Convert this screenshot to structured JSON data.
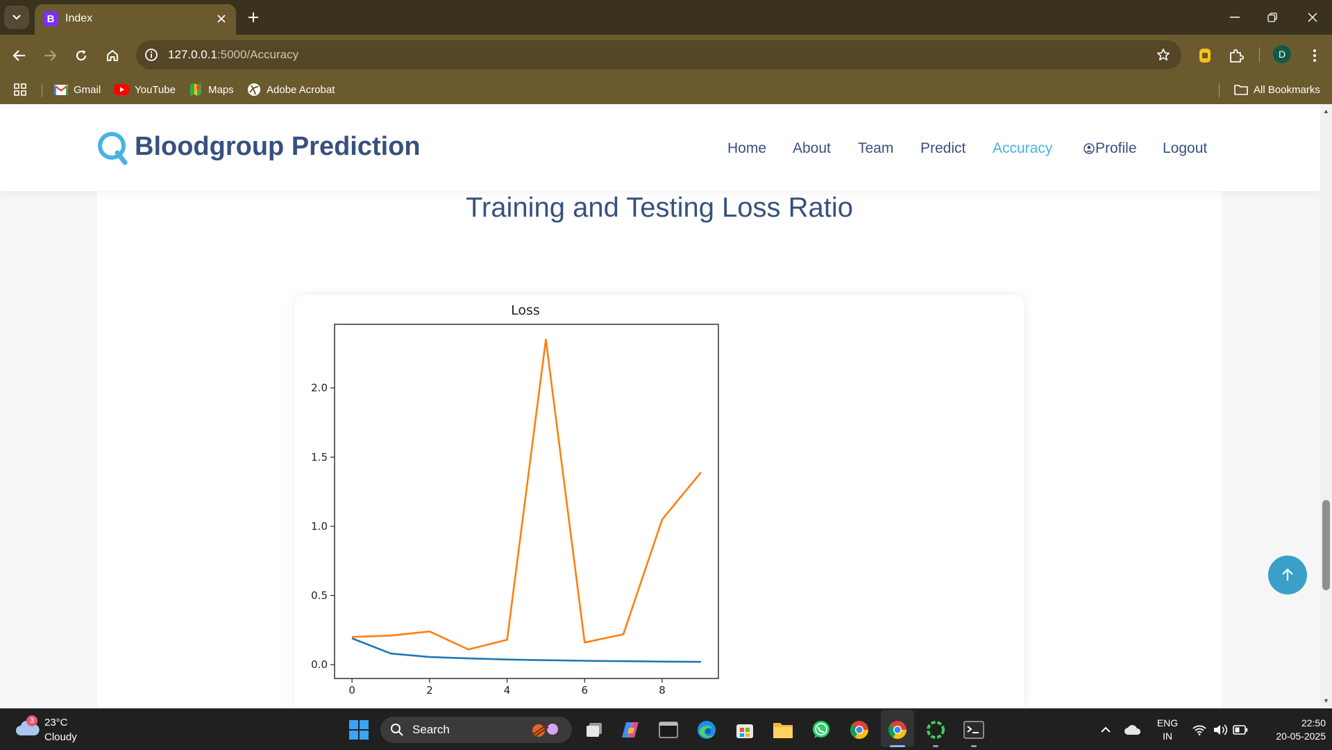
{
  "browser": {
    "tab_title": "Index",
    "tab_favicon_letter": "B",
    "url_host": "127.0.0.1",
    "url_rest": ":5000/Accuracy",
    "profile_initial": "D",
    "bookmarks": [
      {
        "label": "Gmail",
        "icon": "gmail-icon"
      },
      {
        "label": "YouTube",
        "icon": "youtube-icon"
      },
      {
        "label": "Maps",
        "icon": "maps-icon"
      },
      {
        "label": "Adobe Acrobat",
        "icon": "acrobat-icon"
      }
    ],
    "all_bookmarks_label": "All Bookmarks"
  },
  "site": {
    "brand": "Bloodgroup Prediction",
    "accent_color": "#47b2e4",
    "nav": [
      {
        "label": "Home",
        "active": false
      },
      {
        "label": "About",
        "active": false
      },
      {
        "label": "Team",
        "active": false
      },
      {
        "label": "Predict",
        "active": false
      },
      {
        "label": "Accuracy",
        "active": true
      },
      {
        "label": "Profile",
        "active": false
      },
      {
        "label": "Logout",
        "active": false
      }
    ],
    "section_title": "Training and Testing Loss Ratio"
  },
  "chart_data": {
    "type": "line",
    "title": "Loss",
    "xlabel": "",
    "ylabel": "",
    "x": [
      0,
      1,
      2,
      3,
      4,
      5,
      6,
      7,
      8,
      9
    ],
    "xticks": [
      0,
      2,
      4,
      6,
      8
    ],
    "yticks": [
      "0.0",
      "0.5",
      "1.0",
      "1.5",
      "2.0"
    ],
    "xlim": [
      -0.45,
      9.45
    ],
    "ylim": [
      -0.1,
      2.46
    ],
    "grid": false,
    "series": [
      {
        "color": "#1f77b4",
        "values": [
          0.19,
          0.08,
          0.055,
          0.045,
          0.037,
          0.032,
          0.028,
          0.025,
          0.022,
          0.02
        ]
      },
      {
        "color": "#ff7f0e",
        "values": [
          0.2,
          0.21,
          0.24,
          0.11,
          0.18,
          2.35,
          0.16,
          0.22,
          1.05,
          1.39
        ]
      }
    ]
  },
  "taskbar": {
    "weather_temp": "23°C",
    "weather_desc": "Cloudy",
    "weather_badge": "3",
    "search_label": "Search",
    "lang_line1": "ENG",
    "lang_line2": "IN",
    "time": "22:50",
    "date": "20-05-2025"
  }
}
